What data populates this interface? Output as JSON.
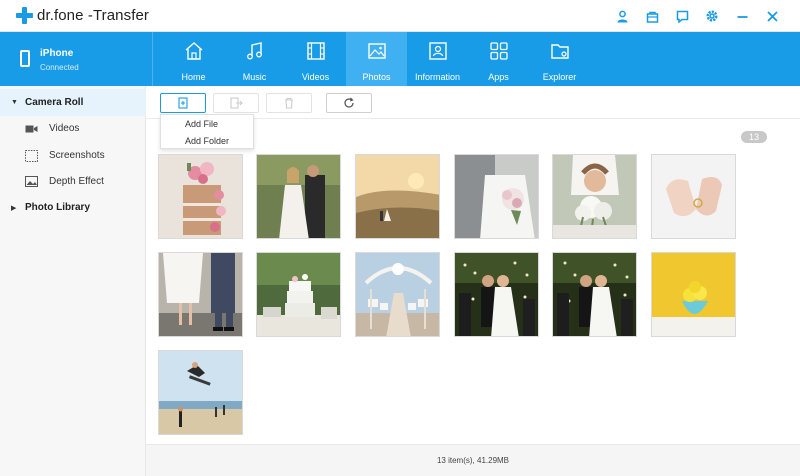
{
  "app": {
    "title_brand": "dr.fone",
    "title_suffix": " -Transfer"
  },
  "window_controls": [
    "user-icon",
    "bag-icon",
    "feedback-icon",
    "settings-icon",
    "minimize-icon",
    "close-icon"
  ],
  "device": {
    "name": "iPhone",
    "status": "Connected"
  },
  "tabs": [
    {
      "label": "Home",
      "icon": "home-icon"
    },
    {
      "label": "Music",
      "icon": "music-icon"
    },
    {
      "label": "Videos",
      "icon": "film-icon"
    },
    {
      "label": "Photos",
      "icon": "photo-icon",
      "active": true
    },
    {
      "label": "Information",
      "icon": "contact-card-icon"
    },
    {
      "label": "Apps",
      "icon": "apps-grid-icon"
    },
    {
      "label": "Explorer",
      "icon": "folder-icon"
    }
  ],
  "sidebar": {
    "camera_roll": "Camera Roll",
    "items": [
      {
        "label": "Videos",
        "icon": "video-camera-icon"
      },
      {
        "label": "Screenshots",
        "icon": "screenshot-icon"
      },
      {
        "label": "Depth Effect",
        "icon": "image-icon"
      }
    ],
    "photo_library": "Photo Library"
  },
  "toolbar": {
    "buttons": [
      "add-icon",
      "export-icon",
      "delete-icon",
      "refresh-icon"
    ]
  },
  "dropdown": {
    "add_file": "Add File",
    "add_folder": "Add Folder"
  },
  "photo_count": "13",
  "photos": [
    {
      "subject": "wedding cake with flowers"
    },
    {
      "subject": "couple outdoors"
    },
    {
      "subject": "couple on hill at sunset"
    },
    {
      "subject": "bride holding bouquet"
    },
    {
      "subject": "bride smelling flowers"
    },
    {
      "subject": "hands with rings"
    },
    {
      "subject": "bride and groom feet"
    },
    {
      "subject": "cake on table in garden"
    },
    {
      "subject": "ceremony aisle"
    },
    {
      "subject": "couple with confetti"
    },
    {
      "subject": "couple with confetti"
    },
    {
      "subject": "lemons in bowl on yellow wall"
    },
    {
      "subject": "skateboarder jumping on beach"
    }
  ],
  "status": "13 item(s), 41.29MB",
  "colors": {
    "accent": "#199ce8",
    "active_tab": "#3fb0f2",
    "sidebar_active": "#e6f3fd"
  }
}
